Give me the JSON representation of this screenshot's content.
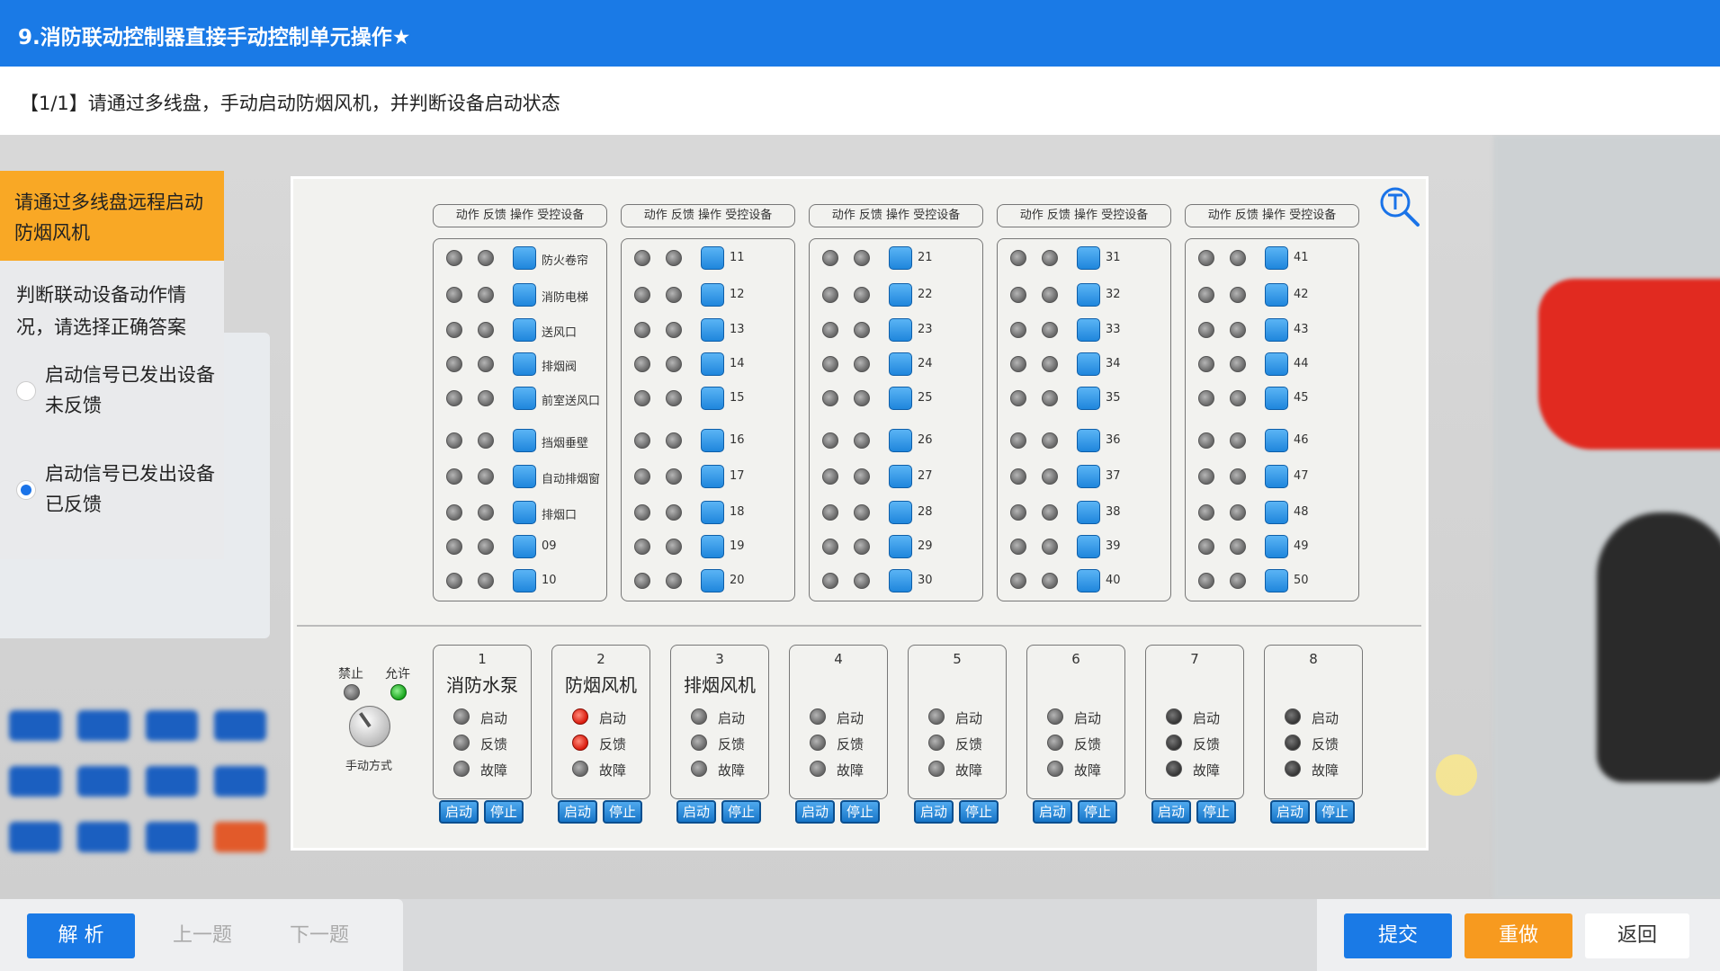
{
  "header": {
    "title": "9.消防联动控制器直接手动控制单元操作★"
  },
  "question": {
    "text": "【1/1】请通过多线盘，手动启动防烟风机，并判断设备启动状态"
  },
  "tasks": {
    "active": "请通过多线盘远程启动防烟风机",
    "prompt": "判断联动设备动作情况，请选择正确答案",
    "options": [
      {
        "label": "启动信号已发出设备未反馈",
        "selected": false
      },
      {
        "label": "启动信号已发出设备已反馈",
        "selected": true
      }
    ]
  },
  "panel": {
    "column_header": "动作 反馈  操作  受控设备",
    "columns": [
      {
        "devices": [
          "防火卷帘",
          "消防电梯",
          "送风口",
          "排烟阀",
          "前室送风口",
          "挡烟垂壁",
          "自动排烟窗",
          "排烟口",
          "09",
          "10"
        ]
      },
      {
        "devices": [
          "11",
          "12",
          "13",
          "14",
          "15",
          "16",
          "17",
          "18",
          "19",
          "20"
        ]
      },
      {
        "devices": [
          "21",
          "22",
          "23",
          "24",
          "25",
          "26",
          "27",
          "28",
          "29",
          "30"
        ]
      },
      {
        "devices": [
          "31",
          "32",
          "33",
          "34",
          "35",
          "36",
          "37",
          "38",
          "39",
          "40"
        ]
      },
      {
        "devices": [
          "41",
          "42",
          "43",
          "44",
          "45",
          "46",
          "47",
          "48",
          "49",
          "50"
        ]
      }
    ],
    "mode": {
      "forbid": "禁止",
      "allow": "允许",
      "label": "手动方式"
    },
    "units": [
      {
        "num": "1",
        "name": "消防水泵",
        "states": [
          "off",
          "off",
          "off"
        ]
      },
      {
        "num": "2",
        "name": "防烟风机",
        "states": [
          "red",
          "red",
          "off"
        ]
      },
      {
        "num": "3",
        "name": "排烟风机",
        "states": [
          "off",
          "off",
          "off"
        ]
      },
      {
        "num": "4",
        "name": "",
        "states": [
          "off",
          "off",
          "off"
        ]
      },
      {
        "num": "5",
        "name": "",
        "states": [
          "off",
          "off",
          "off"
        ]
      },
      {
        "num": "6",
        "name": "",
        "states": [
          "off",
          "off",
          "off"
        ]
      },
      {
        "num": "7",
        "name": "",
        "states": [
          "dark",
          "dark",
          "dark"
        ]
      },
      {
        "num": "8",
        "name": "",
        "states": [
          "dark",
          "dark",
          "dark"
        ]
      }
    ],
    "unit_labels": {
      "start": "启动",
      "feedback": "反馈",
      "fault": "故障",
      "start_btn": "启动",
      "stop_btn": "停止"
    }
  },
  "footer": {
    "analysis": "解 析",
    "prev": "上一题",
    "next": "下一题",
    "submit": "提交",
    "redo": "重做",
    "back": "返回"
  },
  "colors": {
    "primary": "#1a7ae6",
    "accent": "#f9a825",
    "redo": "#f79a1f"
  }
}
